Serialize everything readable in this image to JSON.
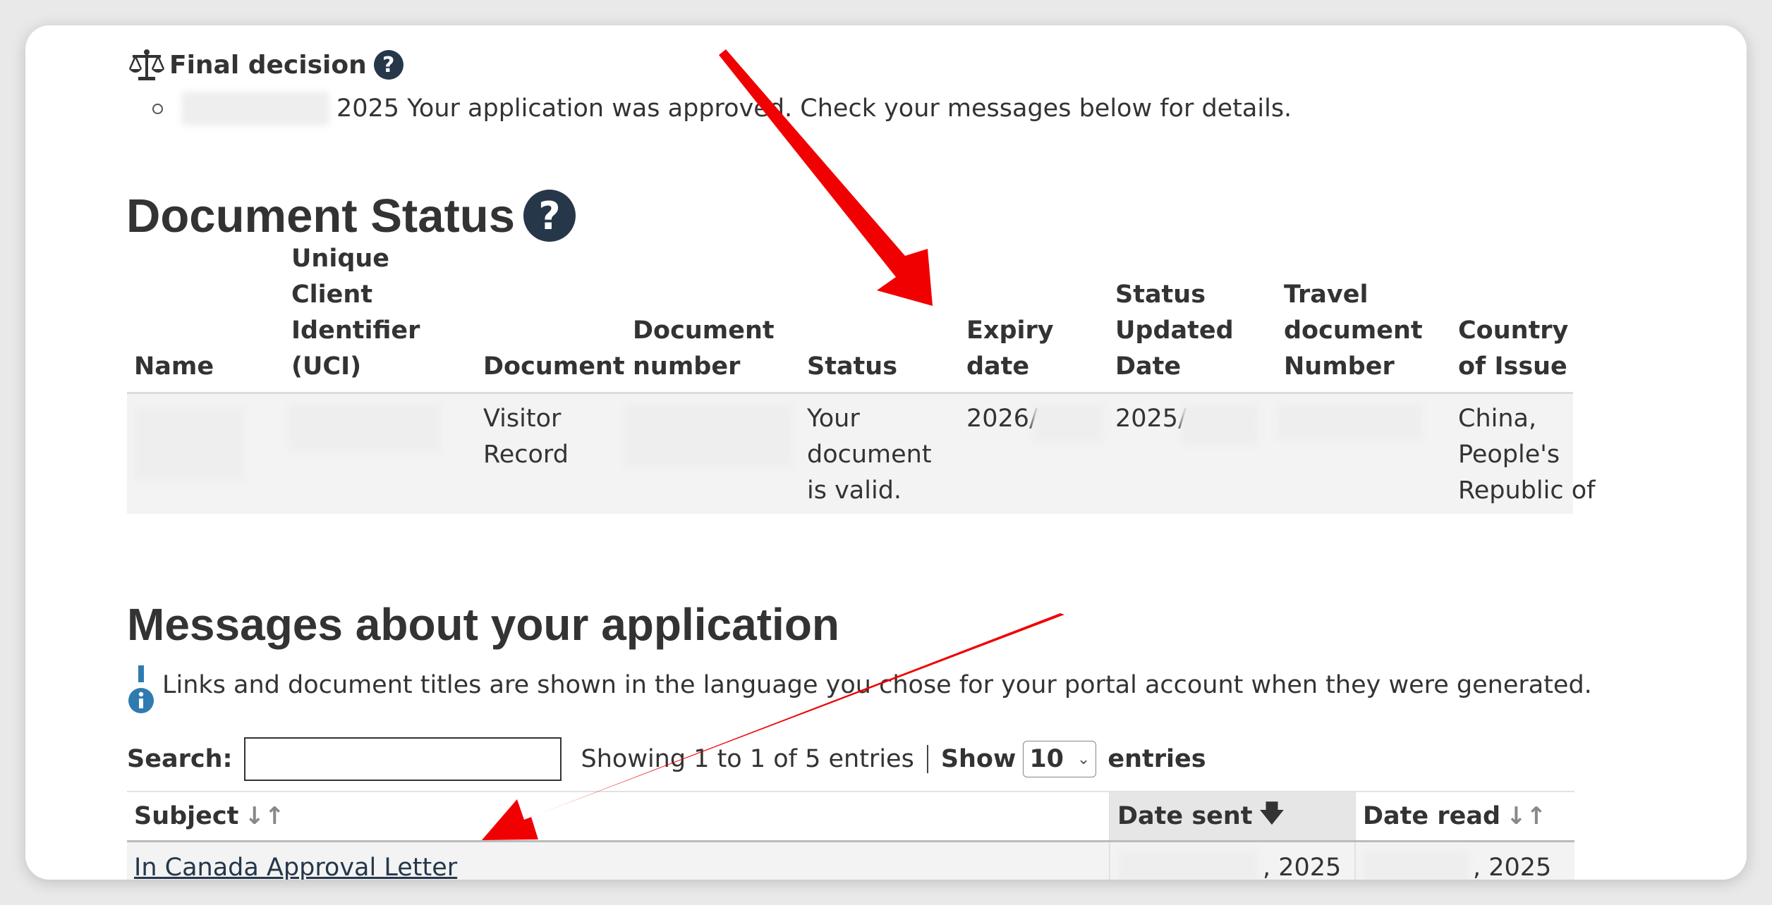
{
  "final_decision": {
    "title": "Final decision",
    "help_icon": "question-circle-icon",
    "scale_icon": "balance-scale-icon",
    "item_text": "2025 Your application was approved. Check your messages below for details."
  },
  "document_status": {
    "title": "Document Status",
    "help_icon": "question-circle-icon",
    "headers": {
      "name": "Name",
      "uci": "Unique Client Identifier (UCI)",
      "document": "Document",
      "document_number": "Document number",
      "status": "Status",
      "expiry_date": "Expiry date",
      "status_updated": "Status Updated Date",
      "travel_doc": "Travel document Number",
      "country": "Country of Issue"
    },
    "row": {
      "document": "Visitor Record",
      "status": "Your document is valid.",
      "expiry_prefix": "2026/",
      "updated_prefix": "2025/",
      "country": "China, People's Republic of"
    }
  },
  "messages": {
    "title": "Messages about your application",
    "info_icon": "info-icon",
    "info_text": "Links and document titles are shown in the language you chose for your portal account when they were generated.",
    "search_label": "Search:",
    "showing_text": "Showing 1 to 1 of 5 entries",
    "show_label": "Show",
    "page_size": "10",
    "entries_label": "entries",
    "columns": {
      "subject": "Subject",
      "date_sent": "Date sent",
      "date_read": "Date read"
    },
    "rows": [
      {
        "subject": "In Canada Approval Letter",
        "date_sent_suffix": ", 2025",
        "date_read_suffix": ", 2025"
      }
    ]
  },
  "annotations": {
    "arrow_color": "#f00000"
  }
}
